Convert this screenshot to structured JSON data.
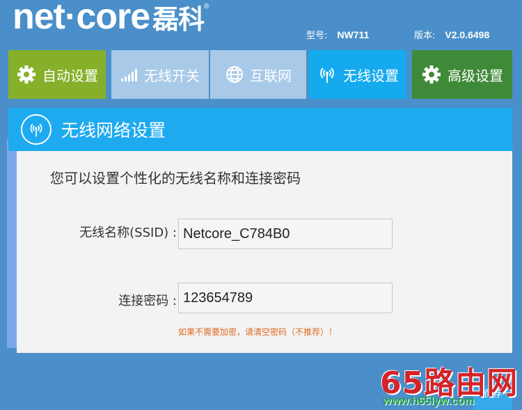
{
  "header": {
    "logo": "net·core",
    "logo_cn": "磊科",
    "reg_mark": "®",
    "model_label": "型号:",
    "model_value": "NW711",
    "version_label": "版本:",
    "version_value": "V2.0.6498"
  },
  "nav": [
    {
      "label": "自动设置",
      "icon": "gear-icon",
      "color": "#86b02a"
    },
    {
      "label": "无线开关",
      "icon": "signal-bars-icon",
      "color": "#a8c9e8"
    },
    {
      "label": "互联网",
      "icon": "globe-icon",
      "color": "#a8c9e8"
    },
    {
      "label": "无线设置",
      "icon": "wifi-antenna-icon",
      "color": "#15aaee"
    },
    {
      "label": "高级设置",
      "icon": "gear-icon",
      "color": "#3f8a38"
    }
  ],
  "panel": {
    "title": "无线网络设置",
    "intro": "您可以设置个性化的无线名称和连接密码",
    "ssid_label": "无线名称(SSID) :",
    "ssid_value": "Netcore_C784B0",
    "password_label": "连接密码 :",
    "password_value": "123654789",
    "hint": "如果不需要加密，请清空密码（不推荐）！",
    "save_label": "保存"
  },
  "watermark": {
    "text": "65路由网",
    "url": "www.h65lyw.com"
  },
  "colors": {
    "background": "#4a8fc9",
    "panel_header": "#1eaaef",
    "hint": "#e06a22",
    "watermark_red": "#d4242a",
    "watermark_green": "#1d9e3f"
  }
}
